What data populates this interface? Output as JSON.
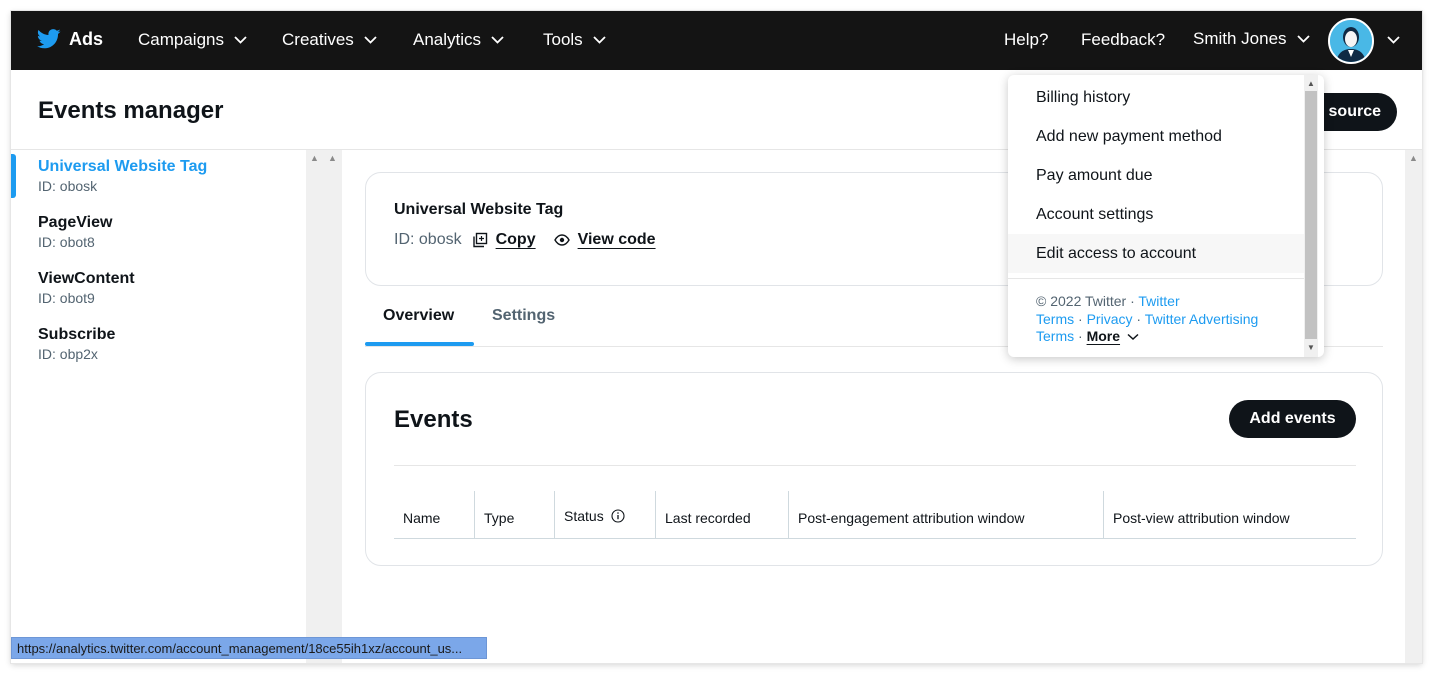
{
  "nav": {
    "brand": "Ads",
    "items": [
      "Campaigns",
      "Creatives",
      "Analytics",
      "Tools"
    ],
    "help": "Help?",
    "feedback": "Feedback?",
    "user": "Smith Jones"
  },
  "header": {
    "title": "Events manager",
    "source_button": "source"
  },
  "sidebar": {
    "items": [
      {
        "title": "Universal Website Tag",
        "id": "ID: obosk"
      },
      {
        "title": "PageView",
        "id": "ID: obot8"
      },
      {
        "title": "ViewContent",
        "id": "ID: obot9"
      },
      {
        "title": "Subscribe",
        "id": "ID: obp2x"
      }
    ]
  },
  "tag_card": {
    "title": "Universal Website Tag",
    "id": "ID: obosk",
    "copy": "Copy",
    "view_code": "View code"
  },
  "tabs": [
    "Overview",
    "Settings"
  ],
  "events": {
    "title": "Events",
    "add_button": "Add events",
    "columns": [
      "Name",
      "Type",
      "Status",
      "Last recorded",
      "Post-engagement attribution window",
      "Post-view attribution window"
    ]
  },
  "menu": {
    "items": [
      "Billing history",
      "Add new payment method",
      "Pay amount due",
      "Account settings",
      "Edit access to account"
    ],
    "footer": {
      "copyright": "© 2022 Twitter ·",
      "link1": "Twitter",
      "link1b": "Terms",
      "link2": "Privacy",
      "link3": "Twitter Advertising",
      "link3b": "Terms",
      "more": "More",
      "dot": "·"
    }
  },
  "statusbar": {
    "url": "https://analytics.twitter.com/account_management/18ce55ih1xz/account_us..."
  },
  "colors": {
    "nav_bg": "#141414",
    "accent": "#1d9bf0",
    "button_bg": "#0f1419"
  }
}
